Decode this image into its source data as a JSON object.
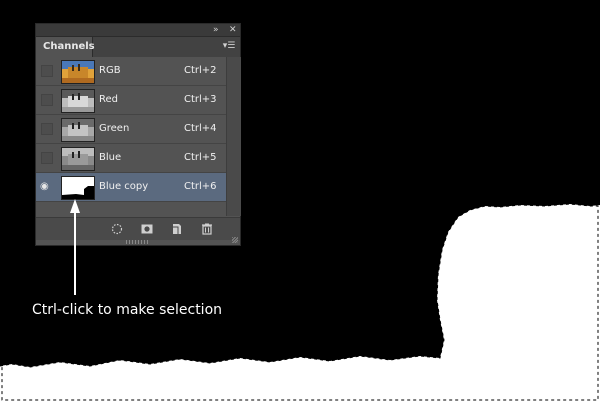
{
  "panel": {
    "tab_label": "Channels",
    "collapse_icon": "double-chevron-right-icon",
    "close_icon": "close-icon",
    "menu_icon": "panel-menu-icon",
    "channels": [
      {
        "name": "RGB",
        "shortcut": "Ctrl+2",
        "visible": false,
        "selected": false
      },
      {
        "name": "Red",
        "shortcut": "Ctrl+3",
        "visible": false,
        "selected": false
      },
      {
        "name": "Green",
        "shortcut": "Ctrl+4",
        "visible": false,
        "selected": false
      },
      {
        "name": "Blue",
        "shortcut": "Ctrl+5",
        "visible": false,
        "selected": false
      },
      {
        "name": "Blue copy",
        "shortcut": "Ctrl+6",
        "visible": true,
        "selected": true
      }
    ],
    "bottom_icons": [
      "load-selection-icon",
      "save-selection-icon",
      "new-channel-icon",
      "trash-icon"
    ]
  },
  "annotation": {
    "text": "Ctrl-click to make selection"
  },
  "colors": {
    "panel_bg": "#535353",
    "selected_row": "#5b6a7f",
    "canvas_bg": "#000000"
  }
}
